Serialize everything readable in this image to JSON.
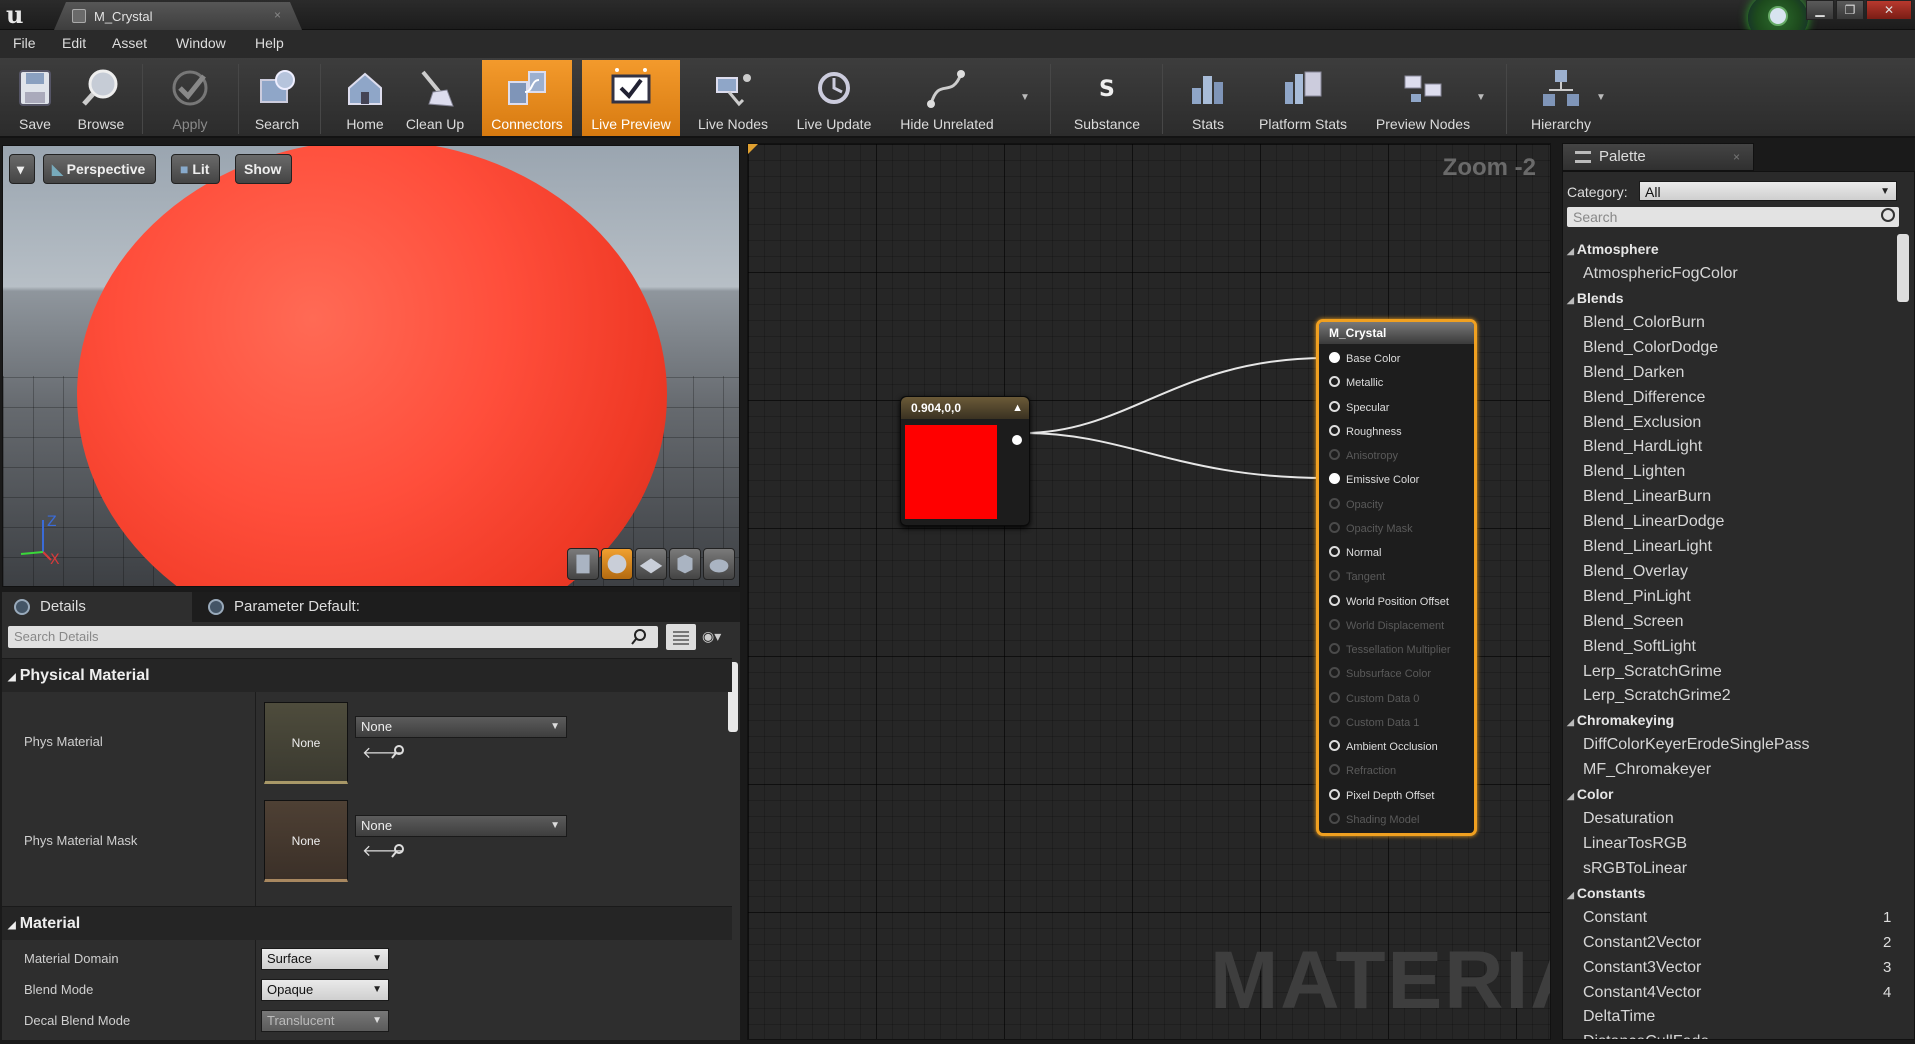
{
  "window": {
    "tab_title": "M_Crystal",
    "tab_close": "×",
    "controls": {
      "minimize": "▁",
      "maximize": "❐",
      "close": "✕"
    }
  },
  "menu": [
    "File",
    "Edit",
    "Asset",
    "Window",
    "Help"
  ],
  "toolbar": {
    "buttons": [
      {
        "label": "Save",
        "icon": "save-icon"
      },
      {
        "label": "Browse",
        "icon": "browse-icon"
      },
      {
        "label": "Apply",
        "icon": "apply-icon",
        "state": "disabled"
      },
      {
        "label": "Search",
        "icon": "search-icon"
      },
      {
        "label": "Home",
        "icon": "home-icon"
      },
      {
        "label": "Clean Up",
        "icon": "cleanup-icon"
      },
      {
        "label": "Connectors",
        "icon": "connectors-icon",
        "state": "active"
      },
      {
        "label": "Live Preview",
        "icon": "live-preview-icon",
        "state": "active"
      },
      {
        "label": "Live Nodes",
        "icon": "live-nodes-icon"
      },
      {
        "label": "Live Update",
        "icon": "live-update-icon"
      },
      {
        "label": "Hide Unrelated",
        "icon": "hide-unrelated-icon"
      },
      {
        "label": "Substance",
        "icon": "substance-icon"
      },
      {
        "label": "Stats",
        "icon": "stats-icon"
      },
      {
        "label": "Platform Stats",
        "icon": "platform-stats-icon"
      },
      {
        "label": "Preview Nodes",
        "icon": "preview-nodes-icon"
      },
      {
        "label": "Hierarchy",
        "icon": "hierarchy-icon"
      }
    ],
    "accent_color": "#f39a2c"
  },
  "viewport": {
    "perspective_label": "Perspective",
    "lit_label": "Lit",
    "show_label": "Show",
    "axis": {
      "z": "Z",
      "x": "X"
    }
  },
  "details": {
    "tabs": [
      "Details",
      "Parameter Default:"
    ],
    "search_placeholder": "Search Details",
    "sections": {
      "physical_material": "Physical Material",
      "material": "Material"
    },
    "phys_material": {
      "label": "Phys Material",
      "thumb": "None",
      "value": "None"
    },
    "phys_material_mask": {
      "label": "Phys Material Mask",
      "thumb": "None",
      "value": "None"
    },
    "material_domain": {
      "label": "Material Domain",
      "value": "Surface"
    },
    "blend_mode": {
      "label": "Blend Mode",
      "value": "Opaque"
    },
    "decal_blend_mode": {
      "label": "Decal Blend Mode",
      "value": "Translucent"
    }
  },
  "graph": {
    "zoom": "Zoom -2",
    "watermark": "MATERIAL",
    "constant_node": {
      "title": "0.904,0,0",
      "color": "#ff0000"
    },
    "material_node": {
      "title": "M_Crystal",
      "pins": [
        {
          "label": "Base Color",
          "state": "connected"
        },
        {
          "label": "Metallic",
          "state": "on"
        },
        {
          "label": "Specular",
          "state": "on"
        },
        {
          "label": "Roughness",
          "state": "on"
        },
        {
          "label": "Anisotropy",
          "state": "off"
        },
        {
          "label": "Emissive Color",
          "state": "connected"
        },
        {
          "label": "Opacity",
          "state": "off"
        },
        {
          "label": "Opacity Mask",
          "state": "off"
        },
        {
          "label": "Normal",
          "state": "on"
        },
        {
          "label": "Tangent",
          "state": "off"
        },
        {
          "label": "World Position Offset",
          "state": "on"
        },
        {
          "label": "World Displacement",
          "state": "off"
        },
        {
          "label": "Tessellation Multiplier",
          "state": "off"
        },
        {
          "label": "Subsurface Color",
          "state": "off"
        },
        {
          "label": "Custom Data 0",
          "state": "off"
        },
        {
          "label": "Custom Data 1",
          "state": "off"
        },
        {
          "label": "Ambient Occlusion",
          "state": "on"
        },
        {
          "label": "Refraction",
          "state": "off"
        },
        {
          "label": "Pixel Depth Offset",
          "state": "on"
        },
        {
          "label": "Shading Model",
          "state": "off"
        }
      ]
    }
  },
  "palette": {
    "tab": "Palette",
    "tab_close": "×",
    "category_label": "Category:",
    "category_value": "All",
    "search_placeholder": "Search",
    "groups": [
      {
        "name": "Atmosphere",
        "items": [
          "AtmosphericFogColor"
        ]
      },
      {
        "name": "Blends",
        "items": [
          "Blend_ColorBurn",
          "Blend_ColorDodge",
          "Blend_Darken",
          "Blend_Difference",
          "Blend_Exclusion",
          "Blend_HardLight",
          "Blend_Lighten",
          "Blend_LinearBurn",
          "Blend_LinearDodge",
          "Blend_LinearLight",
          "Blend_Overlay",
          "Blend_PinLight",
          "Blend_Screen",
          "Blend_SoftLight",
          "Lerp_ScratchGrime",
          "Lerp_ScratchGrime2"
        ]
      },
      {
        "name": "Chromakeying",
        "items": [
          "DiffColorKeyerErodeSinglePass",
          "MF_Chromakeyer"
        ]
      },
      {
        "name": "Color",
        "items": [
          "Desaturation",
          "LinearTosRGB",
          "sRGBToLinear"
        ]
      },
      {
        "name": "Constants",
        "items": [
          "Constant",
          "Constant2Vector",
          "Constant3Vector",
          "Constant4Vector",
          "DeltaTime",
          "DistanceCullFade"
        ],
        "keys": [
          "1",
          "2",
          "3",
          "4",
          "",
          ""
        ]
      }
    ]
  }
}
